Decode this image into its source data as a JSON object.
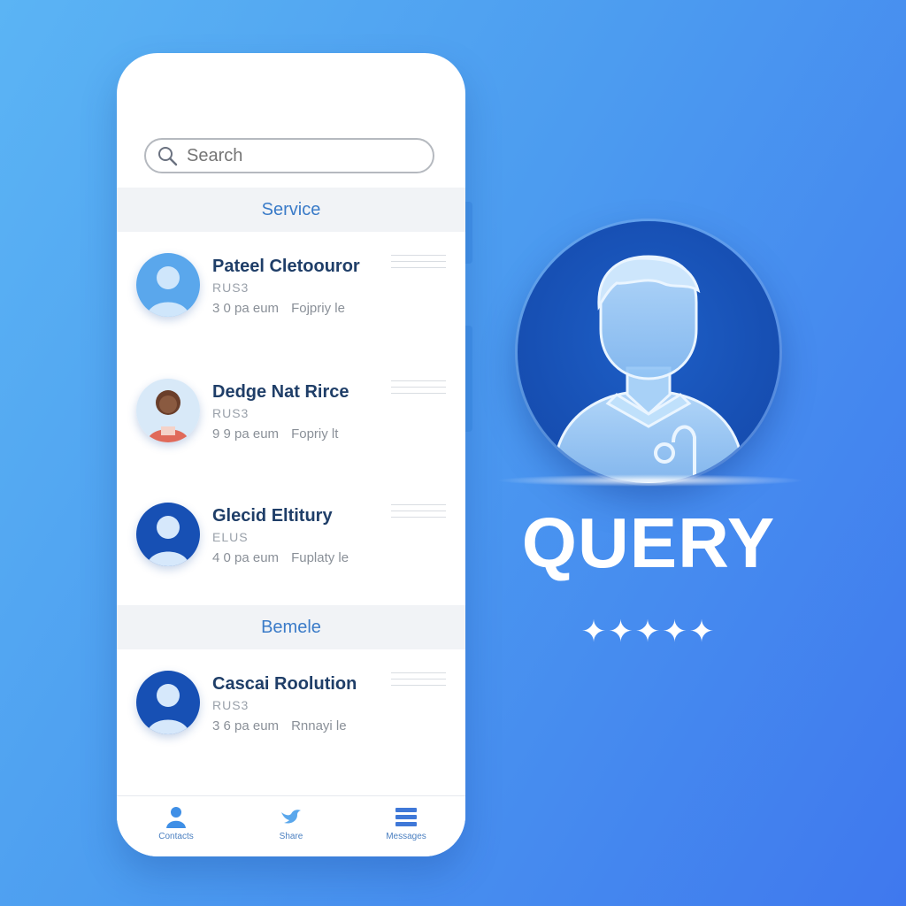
{
  "search": {
    "placeholder": "Search"
  },
  "sections": [
    {
      "title": "Service"
    },
    {
      "title": "Bemele"
    }
  ],
  "contacts": [
    {
      "name": "Pateel Cletoouror",
      "code": "RUS3",
      "meta": "3 0 pa eum",
      "reply": "Fojpriy le"
    },
    {
      "name": "Dedge Nat Rirce",
      "code": "RUS3",
      "meta": "9 9 pa eum",
      "reply": "Fopriy lt"
    },
    {
      "name": "Glecid Eltitury",
      "code": "ELUS",
      "meta": "4 0 pa eum",
      "reply": "Fuplaty le"
    },
    {
      "name": "Cascai Roolution",
      "code": "RUS3",
      "meta": "3 6 pa eum",
      "reply": "Rnnayi le"
    }
  ],
  "tabs": [
    {
      "label": "Contacts"
    },
    {
      "label": "Share"
    },
    {
      "label": "Messages"
    }
  ],
  "hero": {
    "title": "QUERY",
    "stars": "✦✦✦✦✦"
  },
  "colors": {
    "accent": "#1f3e68",
    "brand": "#1750b4",
    "section": "#3a7bc8"
  }
}
